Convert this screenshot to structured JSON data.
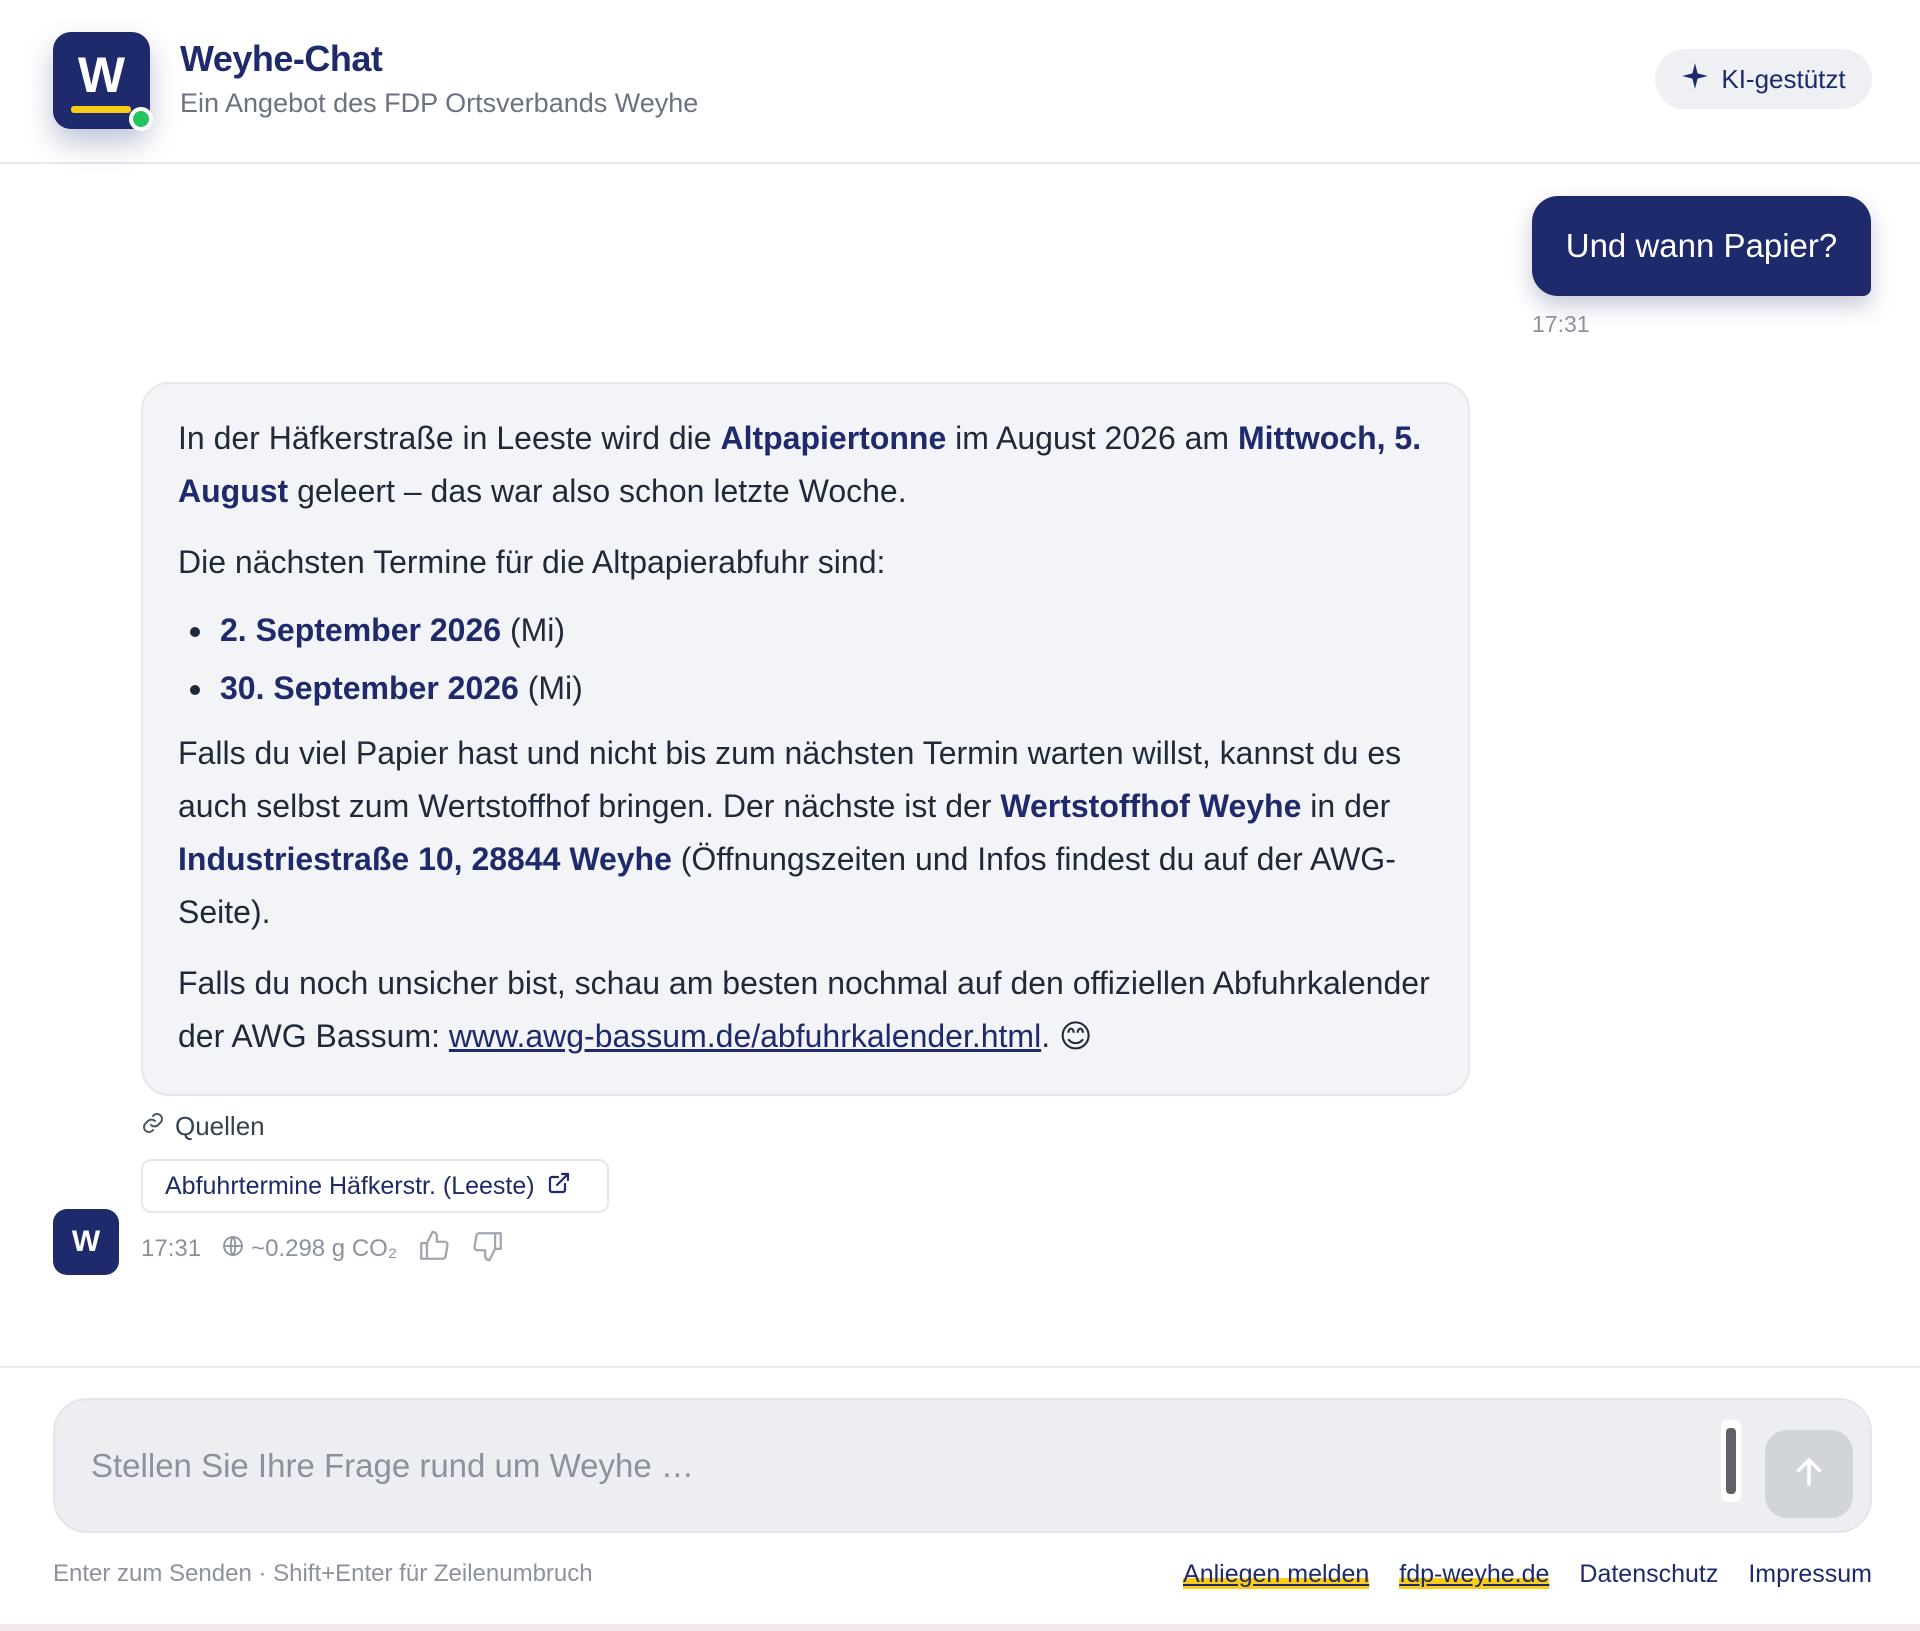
{
  "header": {
    "logo_letter": "W",
    "title": "Weyhe-Chat",
    "subtitle": "Ein Angebot des FDP Ortsverbands Weyhe",
    "ai_badge": "KI-gestützt"
  },
  "user_message": {
    "text": "Und wann Papier?",
    "time": "17:31"
  },
  "bot_message": {
    "p1": {
      "t1": "In der Häfkerstraße in Leeste wird die ",
      "b1": "Altpapiertonne",
      "t2": " im August 2026 am ",
      "b2": "Mittwoch, 5. August",
      "t3": " geleert – das war also schon letzte Woche."
    },
    "p2": "Die nächsten Termine für die Altpapierabfuhr sind:",
    "dates": [
      {
        "date": "2. September 2026",
        "day": " (Mi)"
      },
      {
        "date": "30. September 2026",
        "day": " (Mi)"
      }
    ],
    "p3": {
      "t1": "Falls du viel Papier hast und nicht bis zum nächsten Termin warten willst, kannst du es auch selbst zum Wertstoffhof bringen. Der nächste ist der ",
      "b1": "Wertstoffhof Weyhe",
      "t2": " in der ",
      "b2": "Industriestraße 10, 28844 Weyhe",
      "t3": " (Öffnungszeiten und Infos findest du auf der AWG-Seite)."
    },
    "p4": {
      "t1": "Falls du noch unsicher bist, schau am besten nochmal auf den offiziellen Abfuhrkalender der AWG Bassum: ",
      "link": "www.awg-bassum.de/abfuhrkalender.html",
      "t2": ". ",
      "emoji": "😊"
    },
    "sources_label": "Quellen",
    "source_chip": "Abfuhrtermine Häfkerstr. (Leeste)",
    "avatar_letter": "W",
    "time": "17:31",
    "co2": "~0.298 g CO₂"
  },
  "composer": {
    "placeholder": "Stellen Sie Ihre Frage rund um Weyhe …",
    "value": ""
  },
  "footer": {
    "hint": "Enter zum Senden · Shift+Enter für Zeilenumbruch",
    "links": [
      "Anliegen melden",
      "fdp-weyhe.de",
      "Datenschutz",
      "Impressum"
    ]
  },
  "colors": {
    "brand": "#1e2a6b",
    "accent": "#facc15",
    "online": "#22c55e",
    "bubble_bg": "#f3f4f8"
  },
  "icons": {
    "ai_badge": "sparkle-icon",
    "sources": "link-icon",
    "source_chip": "external-link-icon",
    "co2": "globe-icon",
    "feedback": [
      "thumbs-up-icon",
      "thumbs-down-icon"
    ],
    "send": "arrow-up-icon"
  }
}
